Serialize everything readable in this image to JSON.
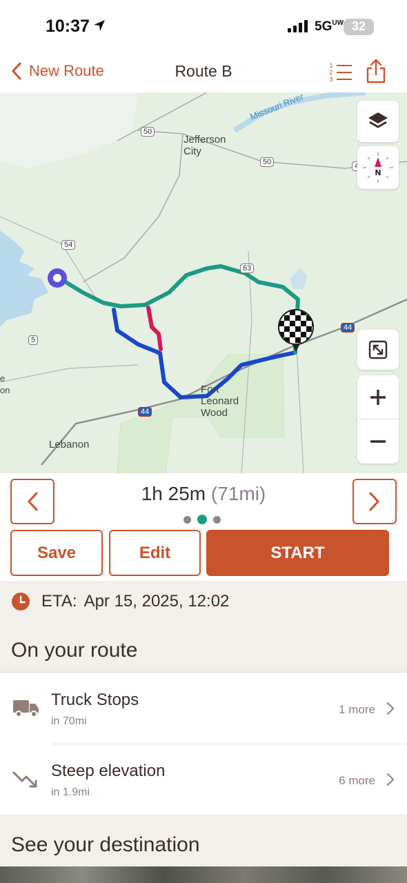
{
  "status_bar": {
    "time": "10:37",
    "network": "5G",
    "network_sub": "UW",
    "battery": "32"
  },
  "nav": {
    "back_label": "New Route",
    "title": "Route B"
  },
  "map": {
    "labels": {
      "river": "Missouri River",
      "jefferson_city": "Jefferson City",
      "fort_leonard_wood": "Fort Leonard Wood",
      "lebanon": "Lebanon",
      "partial_left": "e on"
    },
    "shields": {
      "us50a": "50",
      "us50b": "50",
      "us54": "54",
      "us63": "63",
      "rt5": "5",
      "i44a": "44",
      "i44b": "44",
      "i44c": "44"
    },
    "compass_letter": "N",
    "route_colors": {
      "selected": "#1d9a84",
      "alt_blue": "#1947c9",
      "alt_red": "#d6195a"
    }
  },
  "route_card": {
    "duration": "1h 25m",
    "distance": "(71mi)",
    "page_index": 2,
    "page_count": 3,
    "save_label": "Save",
    "edit_label": "Edit",
    "start_label": "START"
  },
  "eta": {
    "label": "ETA:",
    "value": "Apr 15, 2025, 12:02"
  },
  "on_route": {
    "title": "On your route",
    "items": [
      {
        "name": "Truck Stops",
        "sub": "in 70mi",
        "more": "1 more",
        "icon": "truck-icon"
      },
      {
        "name": "Steep elevation",
        "sub": "in 1.9mi",
        "more": "6 more",
        "icon": "downhill-icon"
      }
    ]
  },
  "destination": {
    "title": "See your destination"
  },
  "colors": {
    "accent": "#c9532b",
    "text": "#3a2e2a",
    "muted": "#8f7f78",
    "teal": "#1d9a84"
  }
}
